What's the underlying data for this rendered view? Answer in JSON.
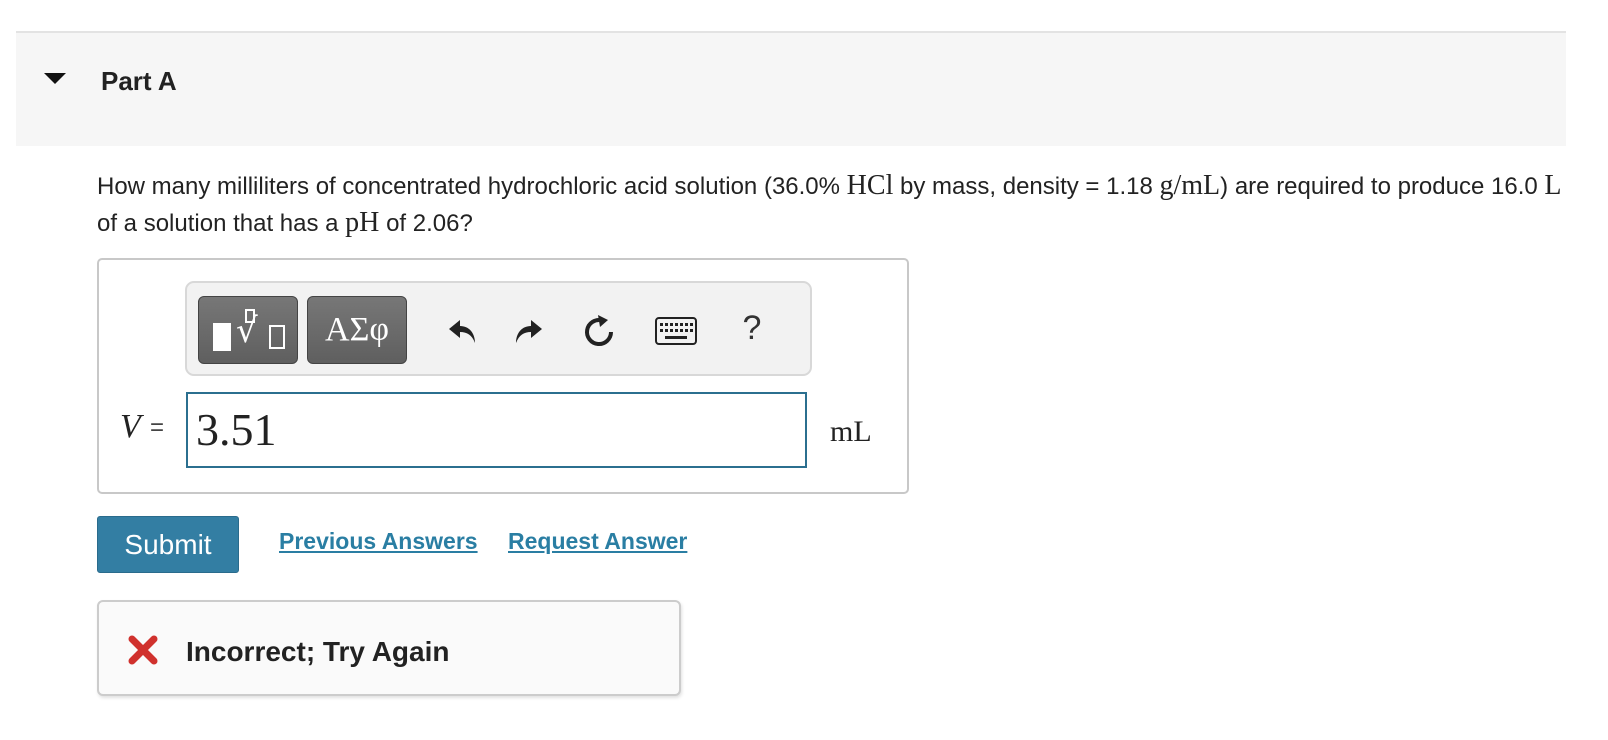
{
  "part": {
    "title": "Part A",
    "caret_icon": "caret-down-icon"
  },
  "question": {
    "text_1": "How many milliliters of concentrated hydrochloric acid solution (36.0% ",
    "math_hcl": "HCl",
    "text_2": " by mass, density = 1.18 ",
    "math_density_unit": "g/mL",
    "text_3": ") are required to produce 16.0 ",
    "math_volume_unit": "L",
    "text_4": " of a solution that has a ",
    "math_ph": "pH",
    "text_5": " of 2.06?"
  },
  "toolbar": {
    "templates_icon": "templates-icon",
    "templates_radical": "√",
    "symbols_label": "ΑΣφ",
    "undo_icon": "undo-icon",
    "redo_icon": "redo-icon",
    "reset_icon": "reset-icon",
    "keyboard_icon": "keyboard-icon",
    "help_label": "?"
  },
  "answer": {
    "variable": "V",
    "equals": "=",
    "value": "3.51",
    "unit": "mL"
  },
  "actions": {
    "submit_label": "Submit",
    "previous_answers": "Previous Answers",
    "request_answer": "Request Answer"
  },
  "feedback": {
    "icon": "x-icon",
    "icon_color": "#d0312d",
    "message": "Incorrect; Try Again"
  },
  "colors": {
    "accent": "#337ea3",
    "link": "#2a7ea3",
    "input_border": "#2b6f8f"
  }
}
